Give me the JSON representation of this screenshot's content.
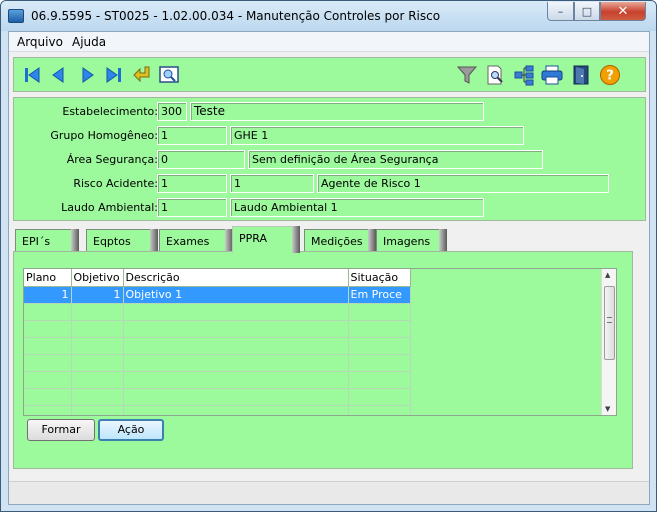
{
  "window": {
    "title": "06.9.5595 - ST0025 - 1.02.00.034 - Manutenção Controles por Risco",
    "controls": {
      "minimize": "–",
      "maximize": "□",
      "close": "✕"
    }
  },
  "menu": {
    "arquivo": "Arquivo",
    "ajuda": "Ajuda"
  },
  "toolbar": {
    "left_icons": [
      "first-record-icon",
      "previous-record-icon",
      "next-record-icon",
      "last-record-icon",
      "return-icon",
      "preview-icon"
    ],
    "right_icons": [
      "filter-icon",
      "search-document-icon",
      "hierarchy-icon",
      "print-icon",
      "exit-door-icon",
      "help-icon"
    ]
  },
  "form": {
    "estabelecimento": {
      "label": "Estabelecimento:",
      "code": "300",
      "name": "Teste"
    },
    "grupo": {
      "label": "Grupo Homogêneo:",
      "code": "1",
      "name": "GHE 1"
    },
    "area": {
      "label": "Área Segurança:",
      "code": "0",
      "name": "Sem definição de Área Segurança"
    },
    "risco": {
      "label": "Risco Acidente:",
      "code1": "1",
      "code2": "1",
      "name": "Agente de Risco 1"
    },
    "laudo": {
      "label": "Laudo Ambiental:",
      "code": "1",
      "name": "Laudo Ambiental 1"
    }
  },
  "tabs": [
    "EPI´s",
    "Eqptos",
    "Exames",
    "PPRA",
    "Medições",
    "Imagens"
  ],
  "active_tab": "PPRA",
  "grid": {
    "columns": [
      "Plano",
      "Objetivo",
      "Descrição",
      "Situação"
    ],
    "rows": [
      {
        "plano": "1",
        "objetivo": "1",
        "descricao": "Objetivo 1",
        "situacao": "Em Proce"
      }
    ]
  },
  "buttons": {
    "formar": "Formar",
    "acao": "Ação"
  },
  "colors": {
    "panel_green": "#9cf99c",
    "selection_blue": "#3399ff"
  }
}
